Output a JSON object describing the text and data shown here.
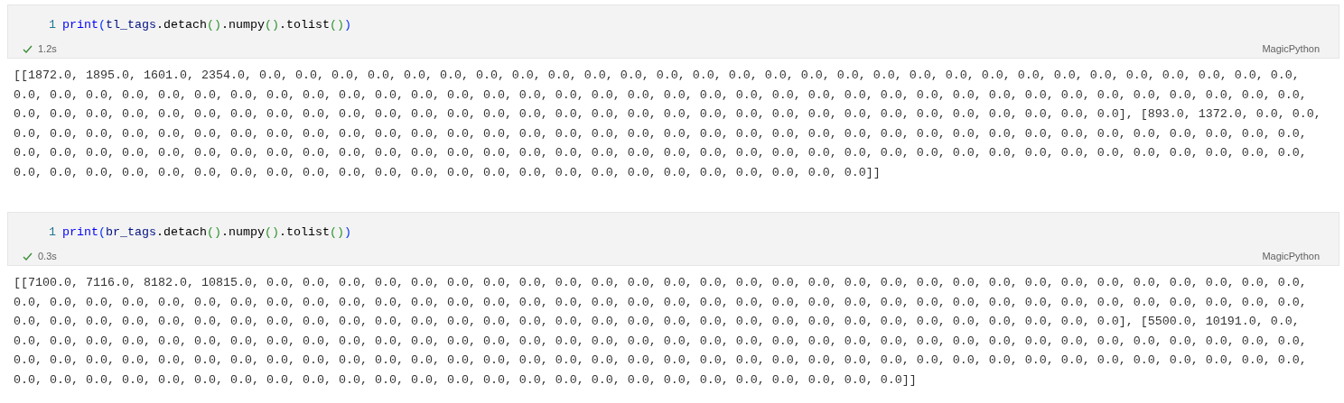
{
  "cells": [
    {
      "line_number": "1",
      "code": [
        {
          "kind": "builtin",
          "text": "print"
        },
        {
          "kind": "bracket",
          "text": "("
        },
        {
          "kind": "variable",
          "text": "tl_tags"
        },
        {
          "kind": "plain",
          "text": ".detach"
        },
        {
          "kind": "inner",
          "text": "()"
        },
        {
          "kind": "plain",
          "text": ".numpy"
        },
        {
          "kind": "inner",
          "text": "()"
        },
        {
          "kind": "plain",
          "text": ".tolist"
        },
        {
          "kind": "inner",
          "text": "()"
        },
        {
          "kind": "bracket",
          "text": ")"
        }
      ],
      "success": true,
      "time": "1.2s",
      "language": "MagicPython",
      "output": [
        "[[1872.0, 1895.0, 1601.0, 2354.0, 0.0, 0.0, 0.0, 0.0, 0.0, 0.0, 0.0, 0.0, 0.0, 0.0, 0.0, 0.0, 0.0, 0.0, 0.0, 0.0, 0.0, 0.0, 0.0, 0.0, 0.0, 0.0, 0.0, 0.0, 0.0, 0.0, 0.0, 0.0, 0.0,",
        "0.0, 0.0, 0.0, 0.0, 0.0, 0.0, 0.0, 0.0, 0.0, 0.0, 0.0, 0.0, 0.0, 0.0, 0.0, 0.0, 0.0, 0.0, 0.0, 0.0, 0.0, 0.0, 0.0, 0.0, 0.0, 0.0, 0.0, 0.0, 0.0, 0.0, 0.0, 0.0, 0.0, 0.0, 0.0, 0.0,",
        "0.0, 0.0, 0.0, 0.0, 0.0, 0.0, 0.0, 0.0, 0.0, 0.0, 0.0, 0.0, 0.0, 0.0, 0.0, 0.0, 0.0, 0.0, 0.0, 0.0, 0.0, 0.0, 0.0, 0.0, 0.0, 0.0, 0.0, 0.0, 0.0, 0.0, 0.0], [893.0, 1372.0, 0.0, 0.0,",
        "0.0, 0.0, 0.0, 0.0, 0.0, 0.0, 0.0, 0.0, 0.0, 0.0, 0.0, 0.0, 0.0, 0.0, 0.0, 0.0, 0.0, 0.0, 0.0, 0.0, 0.0, 0.0, 0.0, 0.0, 0.0, 0.0, 0.0, 0.0, 0.0, 0.0, 0.0, 0.0, 0.0, 0.0, 0.0, 0.0,",
        "0.0, 0.0, 0.0, 0.0, 0.0, 0.0, 0.0, 0.0, 0.0, 0.0, 0.0, 0.0, 0.0, 0.0, 0.0, 0.0, 0.0, 0.0, 0.0, 0.0, 0.0, 0.0, 0.0, 0.0, 0.0, 0.0, 0.0, 0.0, 0.0, 0.0, 0.0, 0.0, 0.0, 0.0, 0.0, 0.0,",
        "0.0, 0.0, 0.0, 0.0, 0.0, 0.0, 0.0, 0.0, 0.0, 0.0, 0.0, 0.0, 0.0, 0.0, 0.0, 0.0, 0.0, 0.0, 0.0, 0.0, 0.0, 0.0, 0.0, 0.0]]"
      ]
    },
    {
      "line_number": "1",
      "code": [
        {
          "kind": "builtin",
          "text": "print"
        },
        {
          "kind": "bracket",
          "text": "("
        },
        {
          "kind": "variable",
          "text": "br_tags"
        },
        {
          "kind": "plain",
          "text": ".detach"
        },
        {
          "kind": "inner",
          "text": "()"
        },
        {
          "kind": "plain",
          "text": ".numpy"
        },
        {
          "kind": "inner",
          "text": "()"
        },
        {
          "kind": "plain",
          "text": ".tolist"
        },
        {
          "kind": "inner",
          "text": "()"
        },
        {
          "kind": "bracket",
          "text": ")"
        }
      ],
      "success": true,
      "time": "0.3s",
      "language": "MagicPython",
      "output": [
        "[[7100.0, 7116.0, 8182.0, 10815.0, 0.0, 0.0, 0.0, 0.0, 0.0, 0.0, 0.0, 0.0, 0.0, 0.0, 0.0, 0.0, 0.0, 0.0, 0.0, 0.0, 0.0, 0.0, 0.0, 0.0, 0.0, 0.0, 0.0, 0.0, 0.0, 0.0, 0.0, 0.0, 0.0,",
        "0.0, 0.0, 0.0, 0.0, 0.0, 0.0, 0.0, 0.0, 0.0, 0.0, 0.0, 0.0, 0.0, 0.0, 0.0, 0.0, 0.0, 0.0, 0.0, 0.0, 0.0, 0.0, 0.0, 0.0, 0.0, 0.0, 0.0, 0.0, 0.0, 0.0, 0.0, 0.0, 0.0, 0.0, 0.0, 0.0,",
        "0.0, 0.0, 0.0, 0.0, 0.0, 0.0, 0.0, 0.0, 0.0, 0.0, 0.0, 0.0, 0.0, 0.0, 0.0, 0.0, 0.0, 0.0, 0.0, 0.0, 0.0, 0.0, 0.0, 0.0, 0.0, 0.0, 0.0, 0.0, 0.0, 0.0, 0.0], [5500.0, 10191.0, 0.0,",
        "0.0, 0.0, 0.0, 0.0, 0.0, 0.0, 0.0, 0.0, 0.0, 0.0, 0.0, 0.0, 0.0, 0.0, 0.0, 0.0, 0.0, 0.0, 0.0, 0.0, 0.0, 0.0, 0.0, 0.0, 0.0, 0.0, 0.0, 0.0, 0.0, 0.0, 0.0, 0.0, 0.0, 0.0, 0.0, 0.0,",
        "0.0, 0.0, 0.0, 0.0, 0.0, 0.0, 0.0, 0.0, 0.0, 0.0, 0.0, 0.0, 0.0, 0.0, 0.0, 0.0, 0.0, 0.0, 0.0, 0.0, 0.0, 0.0, 0.0, 0.0, 0.0, 0.0, 0.0, 0.0, 0.0, 0.0, 0.0, 0.0, 0.0, 0.0, 0.0, 0.0,",
        "0.0, 0.0, 0.0, 0.0, 0.0, 0.0, 0.0, 0.0, 0.0, 0.0, 0.0, 0.0, 0.0, 0.0, 0.0, 0.0, 0.0, 0.0, 0.0, 0.0, 0.0, 0.0, 0.0, 0.0, 0.0]]"
      ]
    }
  ]
}
